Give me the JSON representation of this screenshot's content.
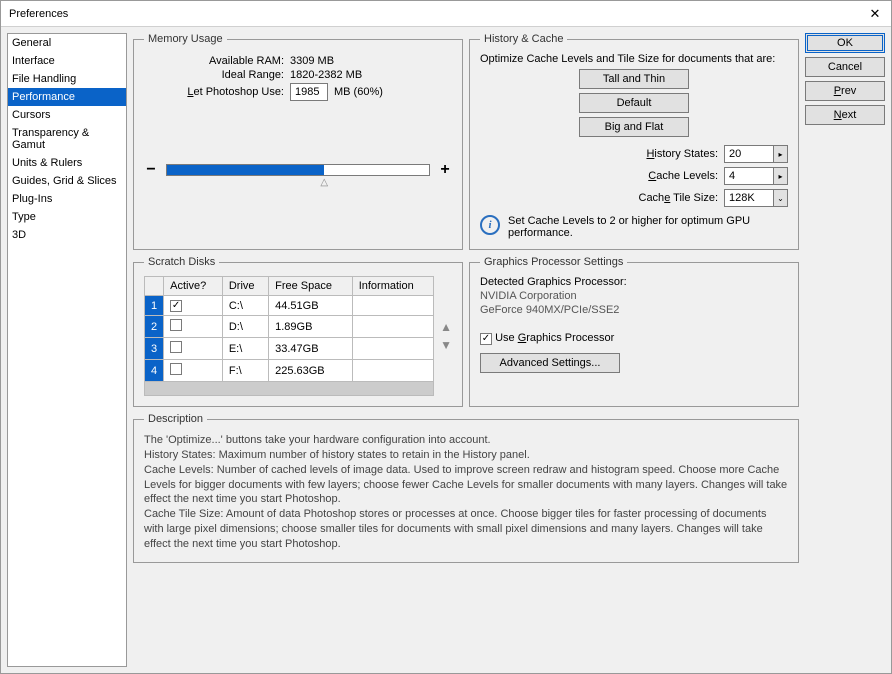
{
  "window": {
    "title": "Preferences"
  },
  "sidebar": {
    "items": [
      "General",
      "Interface",
      "File Handling",
      "Performance",
      "Cursors",
      "Transparency & Gamut",
      "Units & Rulers",
      "Guides, Grid & Slices",
      "Plug-Ins",
      "Type",
      "3D"
    ],
    "selected": "Performance"
  },
  "buttons": {
    "ok": "OK",
    "cancel": "Cancel",
    "prev": "Prev",
    "next": "Next"
  },
  "memory": {
    "legend": "Memory Usage",
    "available_label": "Available RAM:",
    "available_value": "3309 MB",
    "ideal_label": "Ideal Range:",
    "ideal_value": "1820-2382 MB",
    "use_label": "Let Photoshop Use:",
    "use_value": "1985",
    "use_suffix": "MB (60%)",
    "minus": "−",
    "plus": "+"
  },
  "history": {
    "legend": "History & Cache",
    "optimize_text": "Optimize Cache Levels and Tile Size for documents that are:",
    "btn_tall": "Tall and Thin",
    "btn_default": "Default",
    "btn_big": "Big and Flat",
    "states_label": "History States:",
    "states_value": "20",
    "levels_label": "Cache Levels:",
    "levels_value": "4",
    "tile_label": "Cache Tile Size:",
    "tile_value": "128K",
    "info_text": "Set Cache Levels to 2 or higher for optimum GPU performance."
  },
  "scratch": {
    "legend": "Scratch Disks",
    "headers": {
      "active": "Active?",
      "drive": "Drive",
      "free": "Free Space",
      "info": "Information"
    },
    "rows": [
      {
        "n": "1",
        "active": true,
        "drive": "C:\\",
        "free": "44.51GB",
        "info": ""
      },
      {
        "n": "2",
        "active": false,
        "drive": "D:\\",
        "free": "1.89GB",
        "info": ""
      },
      {
        "n": "3",
        "active": false,
        "drive": "E:\\",
        "free": "33.47GB",
        "info": ""
      },
      {
        "n": "4",
        "active": false,
        "drive": "F:\\",
        "free": "225.63GB",
        "info": ""
      }
    ]
  },
  "gpu": {
    "legend": "Graphics Processor Settings",
    "detected_label": "Detected Graphics Processor:",
    "vendor": "NVIDIA Corporation",
    "model": "GeForce 940MX/PCIe/SSE2",
    "use_label": "Use Graphics Processor",
    "use_checked": true,
    "advanced": "Advanced Settings..."
  },
  "description": {
    "legend": "Description",
    "l1": "The 'Optimize...' buttons take your hardware configuration into account.",
    "l2": "History States: Maximum number of history states to retain in the History panel.",
    "l3": "Cache Levels: Number of cached levels of image data.  Used to improve screen redraw and histogram speed.  Choose more Cache Levels for bigger documents with few layers; choose fewer Cache Levels for smaller documents with many layers. Changes will take effect the next time you start Photoshop.",
    "l4": "Cache Tile Size: Amount of data Photoshop stores or processes at once. Choose bigger tiles for faster processing of documents with large pixel dimensions; choose smaller tiles for documents with small pixel dimensions and many layers. Changes will take effect the next time you start Photoshop."
  }
}
